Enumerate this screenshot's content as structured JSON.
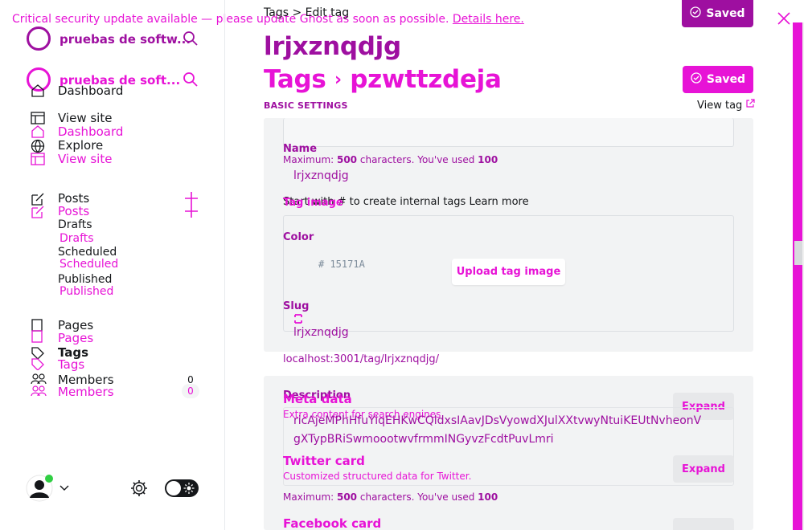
{
  "banner": {
    "text": "Critical security update available — please update Ghost as soon as possible.",
    "link": "Details here."
  },
  "sidebar": {
    "site_name_dark": "pruebas de softw...",
    "site_name_magenta": "pruebas de soft...",
    "nav_dark": {
      "dashboard": "Dashboard",
      "view_site": "View site",
      "explore": "Explore",
      "posts": "Posts",
      "drafts": "Drafts",
      "scheduled": "Scheduled",
      "published": "Published",
      "pages": "Pages",
      "tags": "Tags",
      "members": "Members"
    },
    "nav_magenta": {
      "dashboard": "Dashboard",
      "view_site": "View site",
      "posts": "Posts",
      "drafts": "Drafts",
      "scheduled": "Scheduled",
      "published": "Published",
      "pages": "Pages",
      "tags": "Tags",
      "members": "Members"
    },
    "members_count_dark": "0",
    "members_count_magenta": "0"
  },
  "header": {
    "breadcrumb_dark": "Tags > Edit tag",
    "title_dark": "lrjxznqdjg",
    "breadcrumb_magenta_parent": "Tags",
    "breadcrumb_magenta_child": "pzwttzdeja",
    "saved_label": "Saved",
    "basic_settings": "BASIC SETTINGS",
    "view_tag": "View tag"
  },
  "form": {
    "name_label": "Name",
    "name_hint_prefix": "Maximum: ",
    "name_hint_max": "500",
    "name_hint_mid": " characters. You've used ",
    "name_hint_used": "100",
    "name_value": "lrjxznqdjg",
    "tag_hint": "Start with # to create internal tags Learn more",
    "tag_image_label": "Tag image",
    "color_label": "Color",
    "color_value": "# 15171A",
    "upload_label": "Upload tag image",
    "slug_label": "Slug",
    "slug_value": "lrjxznqdjg",
    "slug_url": "localhost:3001/tag/lrjxznqdjg/",
    "description_label": "Description",
    "description_value_1": "ricAjeMPhHfuYiqEHKwCQldxsIAavJDsVyowdXJulXXtvwyNtuiKEUtNvheonV",
    "description_value_2": "gXTypBRiSwmoootwvfrmmINGyvzFcdtPuvLmri",
    "desc_hint_prefix": "Maximum: ",
    "desc_hint_max": "500",
    "desc_hint_mid": " characters. You've used ",
    "desc_hint_used": "100"
  },
  "cards": {
    "meta_title": "Meta data",
    "meta_desc": "Extra content for search engines",
    "twitter_title": "Twitter card",
    "twitter_desc": "Customized structured data for Twitter.",
    "facebook_title": "Facebook card",
    "expand_label": "Expand"
  },
  "colors": {
    "accent_magenta": "#e713d6",
    "accent_purple": "#9e0fa0",
    "text_dark": "#15171a",
    "panel": "#f2f3f4"
  }
}
